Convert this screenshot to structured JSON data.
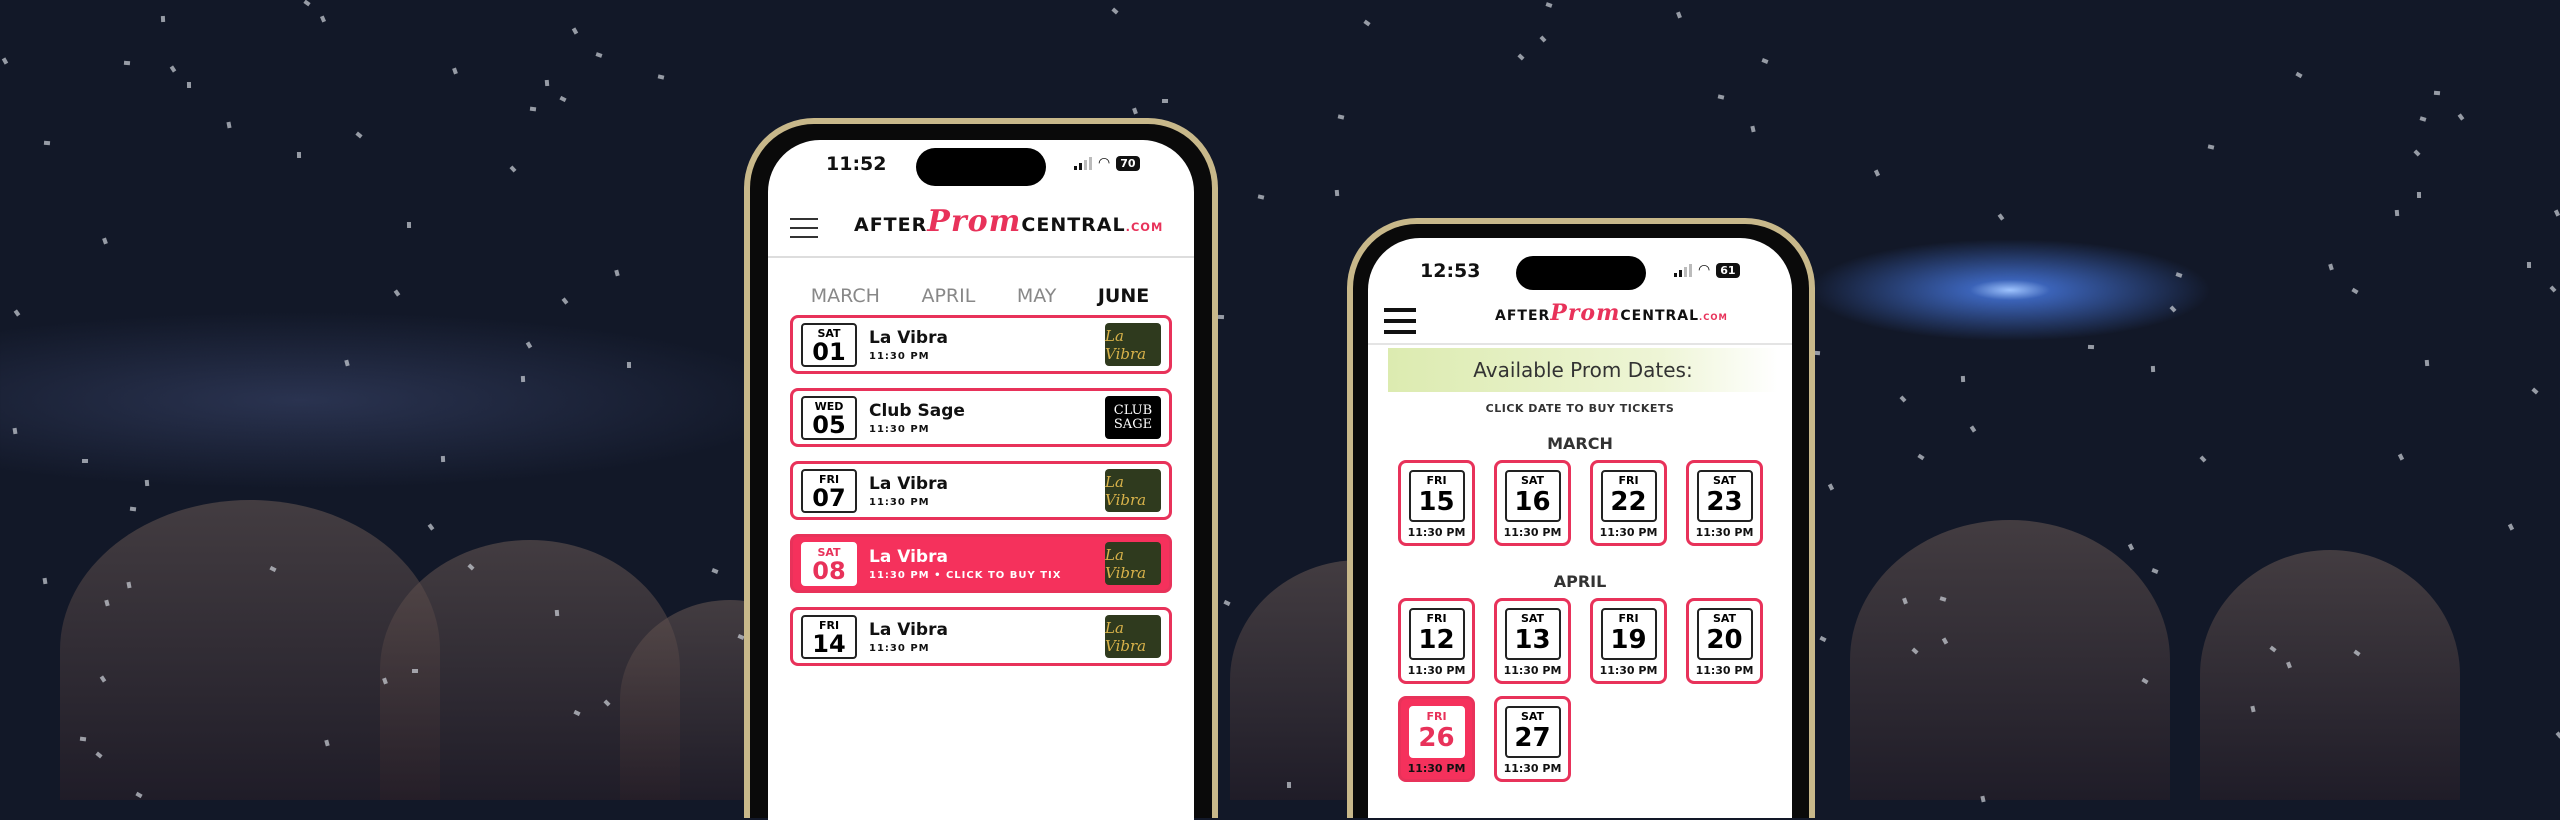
{
  "phone1": {
    "status": {
      "time": "11:52",
      "battery": "70"
    },
    "logo": {
      "after": "AFTER",
      "prom": "Prom",
      "central": "CENTRAL",
      "com": ".COM"
    },
    "tabs": [
      {
        "label": "MARCH"
      },
      {
        "label": "APRIL"
      },
      {
        "label": "MAY"
      },
      {
        "label": "JUNE",
        "active": true
      }
    ],
    "events": [
      {
        "day": "SAT",
        "date": "01",
        "venue": "La Vibra",
        "time": "11:30 PM",
        "thumb": "La Vibra",
        "highlight": false
      },
      {
        "day": "WED",
        "date": "05",
        "venue": "Club Sage",
        "time": "11:30 PM",
        "thumb": "CLUB SAGE",
        "highlight": false
      },
      {
        "day": "FRI",
        "date": "07",
        "venue": "La Vibra",
        "time": "11:30 PM",
        "thumb": "La Vibra",
        "highlight": false
      },
      {
        "day": "SAT",
        "date": "08",
        "venue": "La Vibra",
        "time": "11:30 PM • CLICK TO BUY TIX",
        "thumb": "La Vibra",
        "highlight": true
      },
      {
        "day": "FRI",
        "date": "14",
        "venue": "La Vibra",
        "time": "11:30 PM",
        "thumb": "La Vibra",
        "highlight": false
      }
    ]
  },
  "phone2": {
    "status": {
      "time": "12:53",
      "battery": "61"
    },
    "logo": {
      "after": "AFTER",
      "prom": "Prom",
      "central": "CENTRAL",
      "com": ".COM"
    },
    "banner": "Available Prom Dates:",
    "subtitle": "CLICK DATE TO BUY TICKETS",
    "months": [
      {
        "name": "MARCH",
        "dates": [
          {
            "day": "FRI",
            "date": "15",
            "time": "11:30 PM"
          },
          {
            "day": "SAT",
            "date": "16",
            "time": "11:30 PM"
          },
          {
            "day": "FRI",
            "date": "22",
            "time": "11:30 PM"
          },
          {
            "day": "SAT",
            "date": "23",
            "time": "11:30 PM"
          }
        ]
      },
      {
        "name": "APRIL",
        "dates": [
          {
            "day": "FRI",
            "date": "12",
            "time": "11:30 PM"
          },
          {
            "day": "SAT",
            "date": "13",
            "time": "11:30 PM"
          },
          {
            "day": "FRI",
            "date": "19",
            "time": "11:30 PM"
          },
          {
            "day": "SAT",
            "date": "20",
            "time": "11:30 PM"
          },
          {
            "day": "FRI",
            "date": "26",
            "time": "11:30 PM",
            "highlight": true
          },
          {
            "day": "SAT",
            "date": "27",
            "time": "11:30 PM"
          }
        ]
      }
    ]
  },
  "colors": {
    "accent": "#e8325a",
    "frame": "#c8b88a"
  }
}
